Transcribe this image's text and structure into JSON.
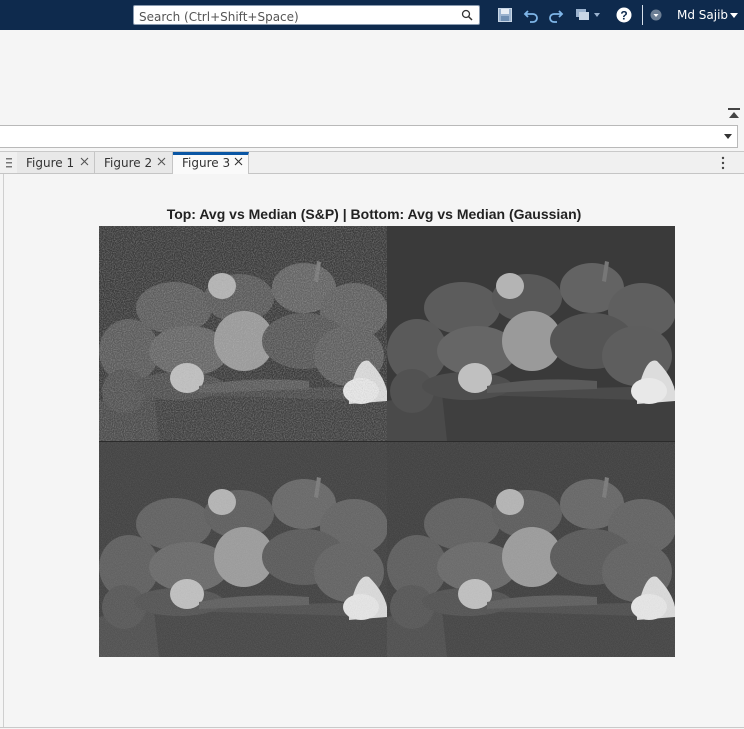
{
  "topbar": {
    "search_placeholder": "Search (Ctrl+Shift+Space)",
    "user_name": "Md Sajib",
    "icons": [
      "save-icon",
      "undo-icon",
      "redo-icon",
      "switch-windows-icon",
      "help-icon",
      "community-icon"
    ]
  },
  "figures": {
    "tabs": [
      {
        "label": "Figure 1",
        "active": false
      },
      {
        "label": "Figure 2",
        "active": false
      },
      {
        "label": "Figure 3",
        "active": true
      }
    ],
    "title": "Top: Avg vs Median (S&P) | Bottom: Avg vs Median (Gaussian)"
  },
  "colors": {
    "topbar": "#0e2a4d",
    "active_tab_accent": "#0a56a4",
    "panel_bg": "#f5f5f5"
  }
}
